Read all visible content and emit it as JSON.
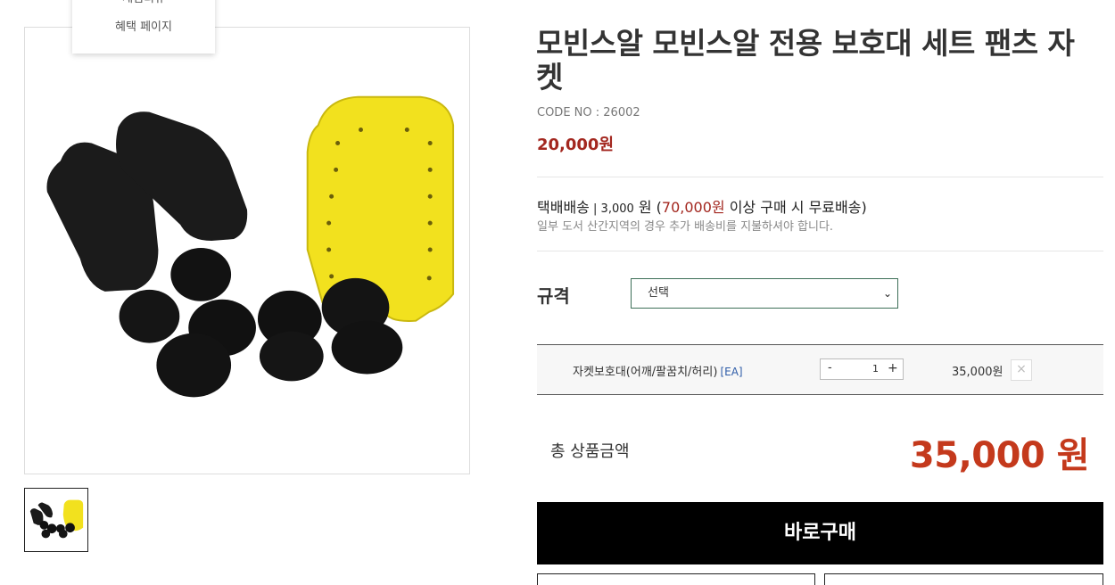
{
  "menu": {
    "partial_item": "재럼리뷰",
    "item": "혜택 페이지"
  },
  "product": {
    "title": "모빈스알 모빈스알 전용 보호대 세트 팬츠 자켓",
    "code_label": "CODE NO : ",
    "code": "26002",
    "price": "20,000원"
  },
  "shipping": {
    "method": "택배배송",
    "sep": " | ",
    "fee": "3,000",
    "won": " 원 (",
    "free_threshold": "70,000원",
    "free_text": " 이상 구매 시 무료배송)",
    "note": "일부 도서 산간지역의 경우 추가 배송비를 지불하셔야 합니다."
  },
  "spec": {
    "label": "규격",
    "selected": "선택",
    "chevron": "⌄"
  },
  "option": {
    "name": "자켓보호대(어깨/팔꿈치/허리)",
    "unit": "[EA]",
    "qty_minus": "-",
    "qty": "1",
    "qty_plus": "+",
    "price": "35,000원",
    "remove": "×"
  },
  "total": {
    "label": "총 상품금액",
    "value": "35,000 원"
  },
  "actions": {
    "buy": "바로구매"
  },
  "colors": {
    "accent_red": "#a3271f",
    "total_red": "#c4391c",
    "select_border": "#3d6f58",
    "buy_bg": "#000000",
    "pad_yellow": "#f2e11e"
  },
  "icons": {
    "chevron": "chevron-down-icon",
    "remove": "close-icon"
  }
}
